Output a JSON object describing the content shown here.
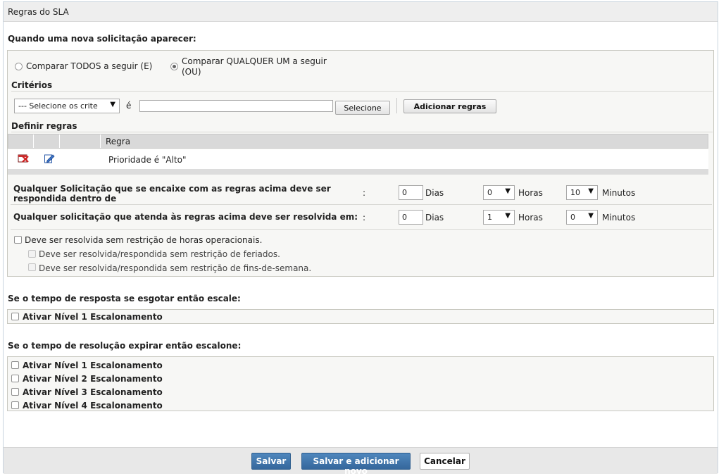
{
  "panel": {
    "title": "Regras do SLA"
  },
  "criteria_section": {
    "heading": "Quando uma nova solicitação aparecer:",
    "radio_all_label": "Comparar TODOS a seguir (E)",
    "radio_any_label_line1": "Comparar QUALQUER UM a seguir",
    "radio_any_label_line2": "(OU)",
    "selected_radio": "any",
    "criteria_label": "Critérios",
    "criteria_select_value": "--- Selecione os crite",
    "equals_label": "é",
    "criteria_value_input": "",
    "select_button_label": "Selecione",
    "add_rules_button_label": "Adicionar regras",
    "define_rules_label": "Definir regras",
    "rules_table": {
      "column_header": "Regra",
      "rows": [
        {
          "rule": "Prioridade é \"Alto\""
        }
      ]
    },
    "response_rule": {
      "label_line1": "Qualquer Solicitação que se encaixe com as regras acima deve ser",
      "label_line2": "respondida dentro de",
      "colon": ":",
      "days_value": "0",
      "days_label": "Dias",
      "hours_value": "0",
      "hours_label": "Horas",
      "minutes_value": "10",
      "minutes_label": "Minutos"
    },
    "resolution_rule": {
      "label": "Qualquer solicitação que atenda às regras acima deve ser resolvida em:",
      "colon": ":",
      "days_value": "0",
      "days_label": "Dias",
      "hours_value": "1",
      "hours_label": "Horas",
      "minutes_value": "0",
      "minutes_label": "Minutos"
    },
    "no_operational_hours_label": "Deve ser resolvida sem restrição de horas operacionais.",
    "no_holidays_label": "Deve ser resolvida/respondida sem restrição de feriados.",
    "no_weekends_label": "Deve ser resolvida/respondida sem restrição de fins-de-semana."
  },
  "response_escalation": {
    "heading": "Se o tempo de resposta se esgotar então escale:",
    "level1_label": "Ativar Nível 1 Escalonamento"
  },
  "resolution_escalation": {
    "heading": "Se o tempo de resolução expirar então escalone:",
    "levels": [
      "Ativar Nível 1 Escalonamento",
      "Ativar Nível 2 Escalonamento",
      "Ativar Nível 3 Escalonamento",
      "Ativar Nível 4 Escalonamento"
    ]
  },
  "footer": {
    "save_label": "Salvar",
    "save_add_new_label": "Salvar e adicionar novo",
    "cancel_label": "Cancelar"
  },
  "icons": {
    "delete_rule": "delete-icon",
    "edit_rule": "edit-icon",
    "dropdown": "chevron-down-icon"
  },
  "colors": {
    "primary_button": "#3a6da3",
    "header_bg": "#eeeeee",
    "box_border": "#c8c8c0"
  }
}
